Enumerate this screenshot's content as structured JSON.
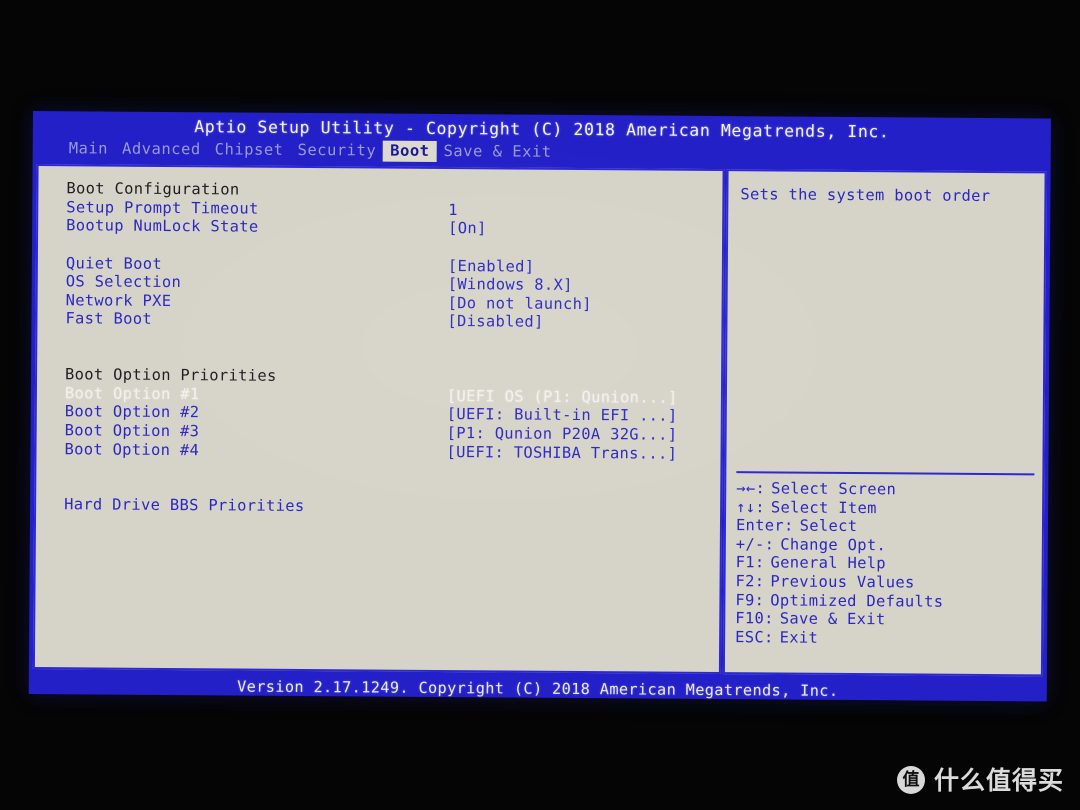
{
  "screen": {
    "title": "Aptio Setup Utility - Copyright (C) 2018 American Megatrends, Inc.",
    "footer": "Version 2.17.1249. Copyright (C) 2018 American Megatrends, Inc.",
    "colors": {
      "screen_blue": "#2320c8",
      "panel_bg": "#d6d3c8",
      "panel_border": "#2d28d2",
      "text_blue": "#2a27c4",
      "text_white": "#f2f1ec",
      "heading_dark": "#1d1d22",
      "tab_inactive": "#9a9ad8",
      "tab_active_bg": "#ddd9cd"
    }
  },
  "menu": {
    "tabs": [
      {
        "label": "Main",
        "active": false
      },
      {
        "label": "Advanced",
        "active": false
      },
      {
        "label": "Chipset",
        "active": false
      },
      {
        "label": "Security",
        "active": false
      },
      {
        "label": "Boot",
        "active": true
      },
      {
        "label": "Save & Exit",
        "active": false
      }
    ]
  },
  "main": {
    "rows": [
      {
        "kind": "heading",
        "label": "Boot Configuration",
        "value": ""
      },
      {
        "kind": "setting",
        "label": "Setup Prompt Timeout",
        "value": "1"
      },
      {
        "kind": "setting",
        "label": "Bootup NumLock State",
        "value": "[On]"
      },
      {
        "kind": "spacer",
        "label": "",
        "value": ""
      },
      {
        "kind": "setting",
        "label": "Quiet Boot",
        "value": "[Enabled]"
      },
      {
        "kind": "setting",
        "label": "OS Selection",
        "value": "[Windows 8.X]"
      },
      {
        "kind": "setting",
        "label": "Network PXE",
        "value": "[Do not launch]"
      },
      {
        "kind": "setting",
        "label": "Fast Boot",
        "value": "[Disabled]"
      },
      {
        "kind": "spacer",
        "label": "",
        "value": ""
      },
      {
        "kind": "spacer",
        "label": "",
        "value": ""
      },
      {
        "kind": "heading",
        "label": "Boot Option Priorities",
        "value": ""
      },
      {
        "kind": "selected",
        "label": "Boot Option #1",
        "value": "[UEFI OS (P1: Qunion...]"
      },
      {
        "kind": "setting",
        "label": "Boot Option #2",
        "value": "[UEFI: Built-in EFI ...]"
      },
      {
        "kind": "setting",
        "label": "Boot Option #3",
        "value": "[P1: Qunion P20A 32G...]"
      },
      {
        "kind": "setting",
        "label": "Boot Option #4",
        "value": "[UEFI: TOSHIBA Trans...]"
      },
      {
        "kind": "spacer",
        "label": "",
        "value": ""
      },
      {
        "kind": "spacer",
        "label": "",
        "value": ""
      },
      {
        "kind": "link",
        "label": "Hard Drive BBS Priorities",
        "value": ""
      }
    ]
  },
  "help": {
    "text": "Sets the system boot order"
  },
  "legend": {
    "rows": [
      {
        "key": "→←",
        "sep": ":",
        "desc": "Select Screen"
      },
      {
        "key": "↑↓",
        "sep": ":",
        "desc": "Select Item"
      },
      {
        "key": "Enter",
        "sep": ":",
        "desc": "Select"
      },
      {
        "key": "+/-",
        "sep": ":",
        "desc": "Change Opt."
      },
      {
        "key": "F1",
        "sep": ":",
        "desc": "General Help"
      },
      {
        "key": "F2",
        "sep": ":",
        "desc": "Previous Values"
      },
      {
        "key": "F9",
        "sep": ":",
        "desc": "Optimized Defaults"
      },
      {
        "key": "F10",
        "sep": ":",
        "desc": "Save & Exit"
      },
      {
        "key": "ESC",
        "sep": ":",
        "desc": "Exit"
      }
    ]
  },
  "watermark": {
    "logo_glyph": "值",
    "text": "什么值得买"
  }
}
